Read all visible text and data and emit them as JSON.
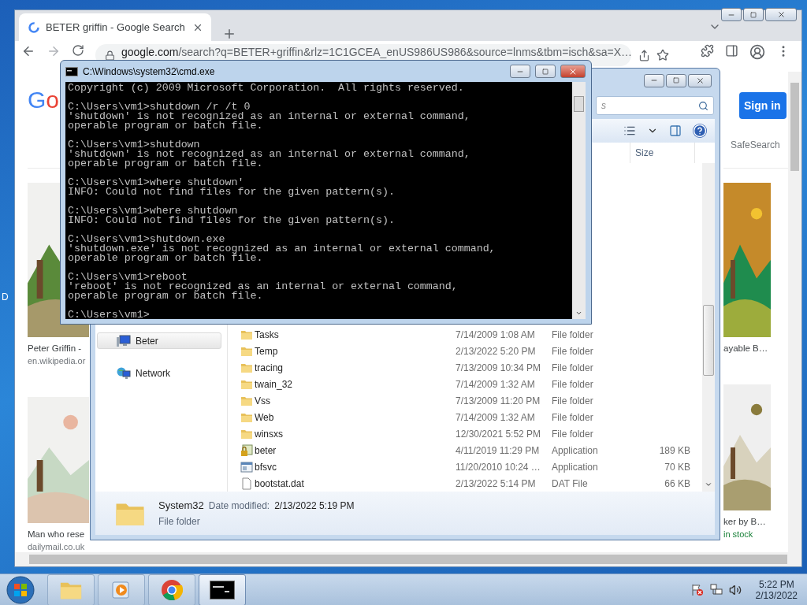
{
  "desktop": {
    "icon_label": "D"
  },
  "browser": {
    "tabs": [
      {
        "title": "BETER griffin - Google Search",
        "selected": true
      }
    ],
    "address": {
      "domain": "google.com",
      "path": "/search?q=BETER+griffin&rlz=1C1GCEA_enUS986US986&source=lnms&tbm=isch&sa=X…"
    },
    "logo": "Go",
    "sign_in": "Sign in",
    "safesearch": "SafeSearch",
    "left_results": [
      {
        "caption": "Peter Griffin -",
        "source": "en.wikipedia.or"
      },
      {
        "caption": "Man who rese",
        "source": "dailymail.co.uk"
      }
    ],
    "right_results": [
      {
        "caption": "ayable B…"
      },
      {
        "caption": "ker by B…",
        "source": "in stock"
      }
    ]
  },
  "explorer": {
    "search": {
      "placeholder": "s"
    },
    "columns": [
      {
        "label": "Size"
      }
    ],
    "nav": [
      {
        "label": "Beter",
        "kind": "computer",
        "selected": true
      },
      {
        "label": "Network",
        "kind": "network",
        "selected": false
      }
    ],
    "files": [
      {
        "name": "Tasks",
        "date": "7/14/2009 1:08 AM",
        "type": "File folder",
        "kind": "folder"
      },
      {
        "name": "Temp",
        "date": "2/13/2022 5:20 PM",
        "type": "File folder",
        "kind": "folder"
      },
      {
        "name": "tracing",
        "date": "7/13/2009 10:34 PM",
        "type": "File folder",
        "kind": "folder"
      },
      {
        "name": "twain_32",
        "date": "7/14/2009 1:32 AM",
        "type": "File folder",
        "kind": "folder"
      },
      {
        "name": "Vss",
        "date": "7/13/2009 11:20 PM",
        "type": "File folder",
        "kind": "folder"
      },
      {
        "name": "Web",
        "date": "7/14/2009 1:32 AM",
        "type": "File folder",
        "kind": "folder"
      },
      {
        "name": "winsxs",
        "date": "12/30/2021 5:52 PM",
        "type": "File folder",
        "kind": "folder"
      },
      {
        "name": "beter",
        "date": "4/11/2019 11:29 PM",
        "type": "Application",
        "size": "189 KB",
        "kind": "locked-app"
      },
      {
        "name": "bfsvc",
        "date": "11/20/2010 10:24 …",
        "type": "Application",
        "size": "70 KB",
        "kind": "app"
      },
      {
        "name": "bootstat.dat",
        "date": "2/13/2022 5:14 PM",
        "type": "DAT File",
        "size": "66 KB",
        "kind": "file"
      }
    ],
    "details": {
      "name": "System32",
      "date_label": "Date modified:",
      "date": "2/13/2022 5:19 PM",
      "type": "File folder"
    }
  },
  "cmd": {
    "title": "C:\\Windows\\system32\\cmd.exe",
    "blocks": [
      {
        "lines": [
          "Copyright (c) 2009 Microsoft Corporation.  All rights reserved."
        ]
      },
      {
        "lines": [
          "C:\\Users\\vm1>shutdown /r /t 0",
          "'shutdown' is not recognized as an internal or external command,",
          "operable program or batch file."
        ]
      },
      {
        "lines": [
          "C:\\Users\\vm1>shutdown",
          "'shutdown' is not recognized as an internal or external command,",
          "operable program or batch file."
        ]
      },
      {
        "lines": [
          "C:\\Users\\vm1>where shutdown'",
          "INFO: Could not find files for the given pattern(s)."
        ]
      },
      {
        "lines": [
          "C:\\Users\\vm1>where shutdown",
          "INFO: Could not find files for the given pattern(s)."
        ]
      },
      {
        "lines": [
          "C:\\Users\\vm1>shutdown.exe",
          "'shutdown.exe' is not recognized as an internal or external command,",
          "operable program or batch file."
        ]
      },
      {
        "lines": [
          "C:\\Users\\vm1>reboot",
          "'reboot' is not recognized as an internal or external command,",
          "operable program or batch file."
        ]
      },
      {
        "lines": [
          "C:\\Users\\vm1>"
        ]
      }
    ]
  },
  "taskbar": {
    "apps": [
      {
        "kind": "explorer",
        "selected": false
      },
      {
        "kind": "media",
        "selected": false
      },
      {
        "kind": "chrome",
        "selected": false
      },
      {
        "kind": "console",
        "selected": true
      }
    ],
    "time": "5:22 PM",
    "date": "2/13/2022"
  }
}
